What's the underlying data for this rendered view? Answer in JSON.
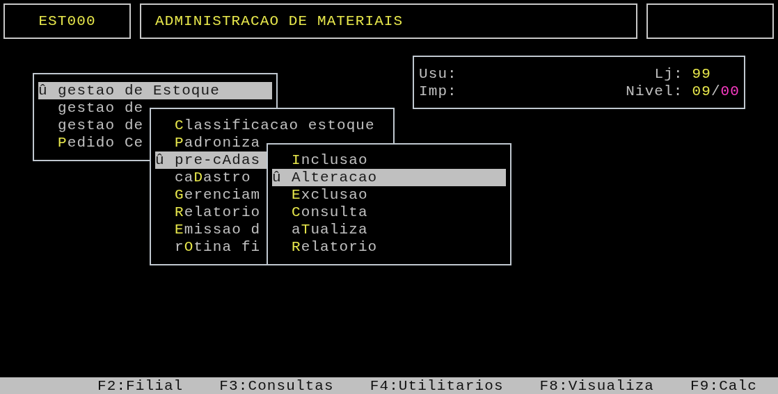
{
  "header": {
    "program_code": "EST000",
    "title": "ADMINISTRACAO DE MATERIAIS"
  },
  "info": {
    "user_label": "Usu:",
    "printer_label": "Imp:",
    "store_label": "Lj:",
    "store": "99",
    "level_label": "Nivel:",
    "level_values": [
      {
        "text": "09",
        "color": "#e8e84c"
      },
      {
        "text": "00",
        "color": "#ff3cc8"
      }
    ],
    "separator": "/"
  },
  "menus": [
    {
      "items": [
        {
          "selected": true,
          "marker": "û",
          "before": "gestao de Estoque"
        },
        {
          "selected": false,
          "before": "gestao de"
        },
        {
          "selected": false,
          "before": "gestao de"
        },
        {
          "selected": false,
          "hotkey": "P",
          "after": "edido Ce"
        }
      ]
    },
    {
      "items": [
        {
          "selected": false,
          "hotkey": "C",
          "after": "lassificacao estoque"
        },
        {
          "selected": false,
          "hotkey": "P",
          "after": "adroniza"
        },
        {
          "selected": true,
          "marker": "û",
          "before": "pre-cAdas"
        },
        {
          "selected": false,
          "before": "ca",
          "hotkey": "D",
          "after": "astro"
        },
        {
          "selected": false,
          "hotkey": "G",
          "after": "erenciam"
        },
        {
          "selected": false,
          "hotkey": "R",
          "after": "elatorio"
        },
        {
          "selected": false,
          "hotkey": "E",
          "after": "missao d"
        },
        {
          "selected": false,
          "before": "r",
          "hotkey": "O",
          "after": "tina fi"
        }
      ]
    },
    {
      "items": [
        {
          "selected": false,
          "hotkey": "I",
          "after": "nclusao"
        },
        {
          "selected": true,
          "marker": "û",
          "before": "Alteracao"
        },
        {
          "selected": false,
          "hotkey": "E",
          "after": "xclusao"
        },
        {
          "selected": false,
          "hotkey": "C",
          "after": "onsulta"
        },
        {
          "selected": false,
          "before": "a",
          "hotkey": "T",
          "after": "ualiza"
        },
        {
          "selected": false,
          "hotkey": "R",
          "after": "elatorio"
        }
      ]
    }
  ],
  "function_keys": [
    "F2:Filial",
    "F3:Consultas",
    "F4:Utilitarios",
    "F8:Visualiza",
    "F9:Calc"
  ]
}
